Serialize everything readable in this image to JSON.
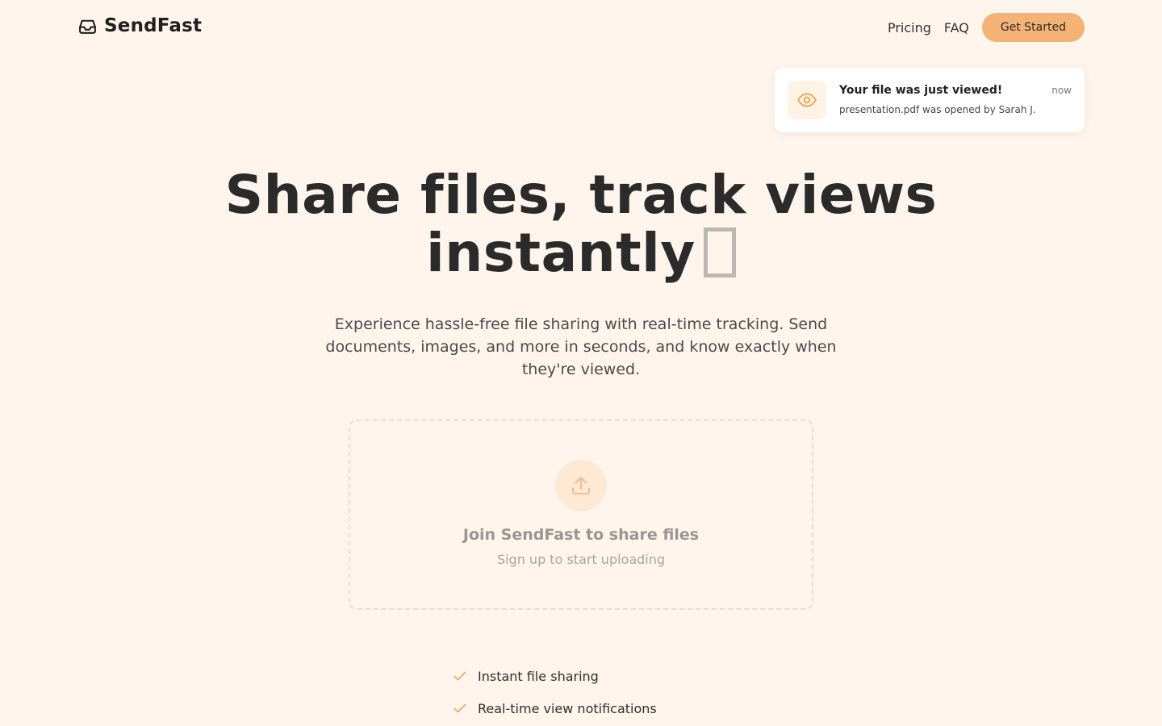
{
  "header": {
    "brand": "SendFast",
    "nav": {
      "pricing": "Pricing",
      "faq": "FAQ",
      "cta": "Get Started"
    }
  },
  "notification": {
    "title": "Your file was just viewed!",
    "body": "presentation.pdf was opened by Sarah J.",
    "time": "now"
  },
  "hero": {
    "title_line1": "Share files, track views",
    "title_line2": "instantly",
    "subtitle": "Experience hassle-free file sharing with real-time tracking. Send documents, images, and more in seconds, and know exactly when they're viewed."
  },
  "dropzone": {
    "title": "Join SendFast to share files",
    "subtitle": "Sign up to start uploading"
  },
  "features": [
    "Instant file sharing",
    "Real-time view notifications"
  ],
  "colors": {
    "background": "#fff5ec",
    "accent": "#f4b274",
    "text": "#2b2b2b"
  }
}
